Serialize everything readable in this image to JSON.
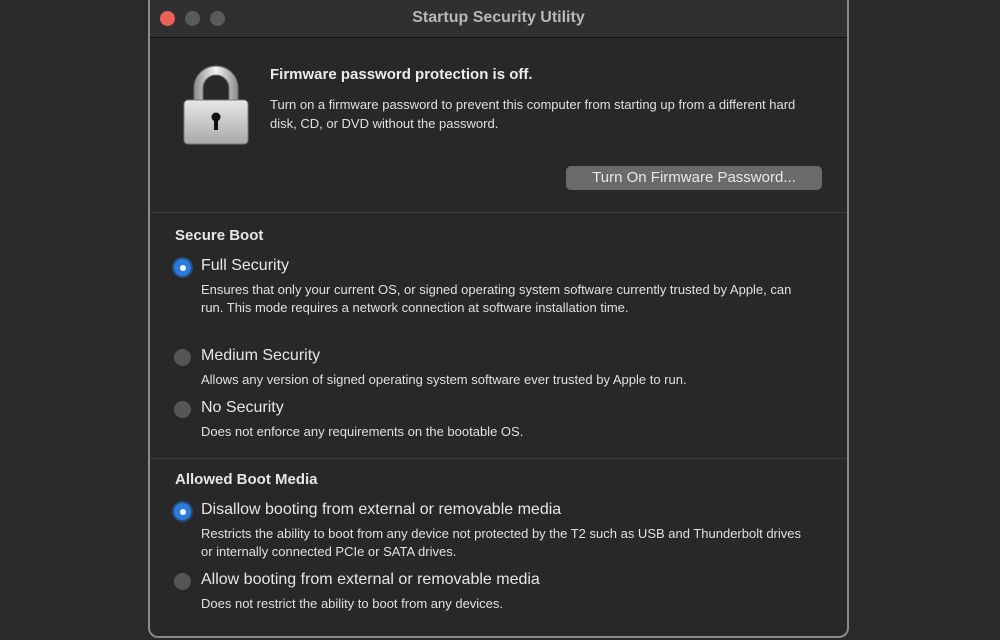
{
  "window": {
    "title": "Startup Security Utility",
    "traffic_lights": [
      "close",
      "minimize",
      "zoom"
    ]
  },
  "firmware": {
    "icon": "padlock-icon",
    "heading": "Firmware password protection is off.",
    "description": "Turn on a firmware password to prevent this computer from starting up from a different hard disk, CD, or DVD without the password.",
    "button_label": "Turn On Firmware Password..."
  },
  "secure_boot": {
    "title": "Secure Boot",
    "options": [
      {
        "label": "Full Security",
        "description": "Ensures that only your current OS, or signed operating system software currently trusted by Apple, can run. This mode requires a network connection at software installation time.",
        "selected": true
      },
      {
        "label": "Medium Security",
        "description": "Allows any version of signed operating system software ever trusted by Apple to run.",
        "selected": false
      },
      {
        "label": "No Security",
        "description": "Does not enforce any requirements on the bootable OS.",
        "selected": false
      }
    ]
  },
  "boot_media": {
    "title": "Allowed Boot Media",
    "options": [
      {
        "label": "Disallow booting from external or removable media",
        "description": "Restricts the ability to boot from any device not protected by the T2 such as USB and Thunderbolt drives or internally connected PCIe or SATA drives.",
        "selected": true
      },
      {
        "label": "Allow booting from external or removable media",
        "description": "Does not restrict the ability to boot from any devices.",
        "selected": false
      }
    ]
  },
  "colors": {
    "accent": "#2a7be0",
    "close": "#ec5f57",
    "background": "#282828"
  }
}
